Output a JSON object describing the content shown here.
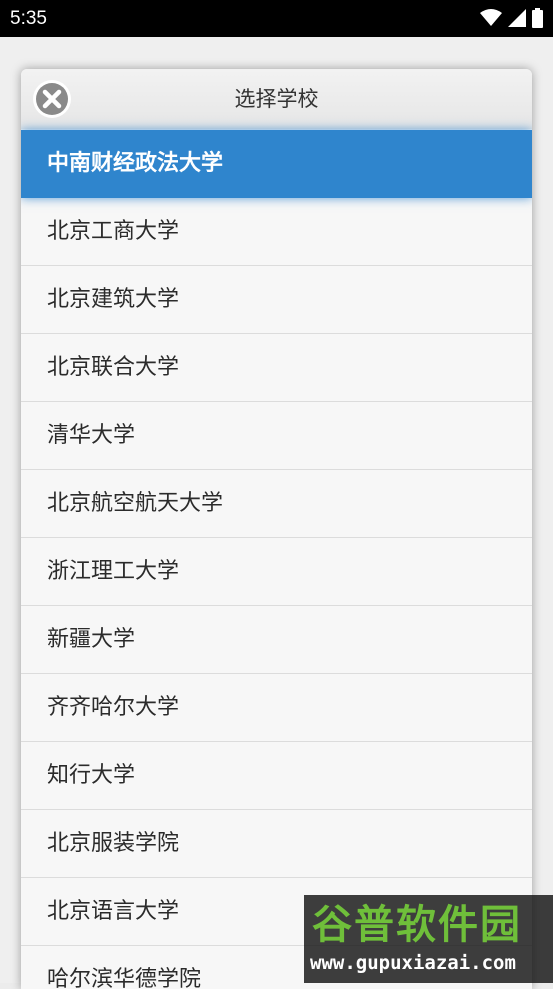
{
  "status_bar": {
    "time": "5:35",
    "icons": [
      "wifi-icon",
      "signal-icon",
      "battery-icon"
    ]
  },
  "dialog": {
    "title": "选择学校",
    "close_icon": "close-circle-icon",
    "schools": [
      {
        "name": "中南财经政法大学",
        "selected": true
      },
      {
        "name": "北京工商大学",
        "selected": false
      },
      {
        "name": "北京建筑大学",
        "selected": false
      },
      {
        "name": "北京联合大学",
        "selected": false
      },
      {
        "name": "清华大学",
        "selected": false
      },
      {
        "name": "北京航空航天大学",
        "selected": false
      },
      {
        "name": "浙江理工大学",
        "selected": false
      },
      {
        "name": "新疆大学",
        "selected": false
      },
      {
        "name": "齐齐哈尔大学",
        "selected": false
      },
      {
        "name": "知行大学",
        "selected": false
      },
      {
        "name": "北京服装学院",
        "selected": false
      },
      {
        "name": "北京语言大学",
        "selected": false
      },
      {
        "name": "哈尔滨华德学院",
        "selected": false
      }
    ]
  },
  "watermark": {
    "title": "谷普软件园",
    "url": "www.gupuxiazai.com"
  },
  "colors": {
    "selected_bg": "#2f85cd",
    "status_bar_bg": "#000000",
    "watermark_green": "#6fbf3a"
  }
}
